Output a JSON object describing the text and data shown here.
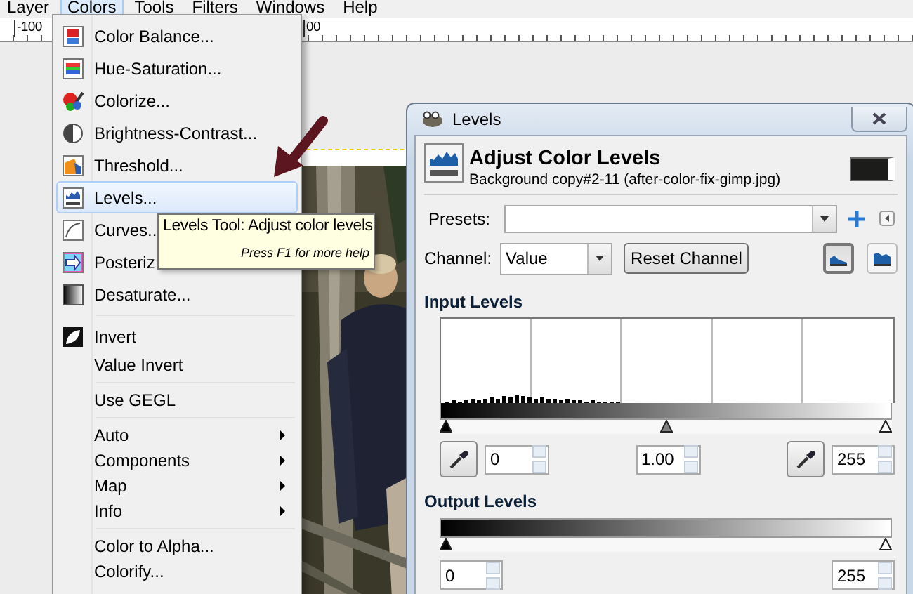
{
  "menubar": [
    {
      "label": "Layer",
      "selected": false
    },
    {
      "label": "Colors",
      "selected": true
    },
    {
      "label": "Tools",
      "selected": false
    },
    {
      "label": "Filters",
      "selected": false
    },
    {
      "label": "Windows",
      "selected": false
    },
    {
      "label": "Help",
      "selected": false
    }
  ],
  "ruler": {
    "labels": [
      "-100",
      "00"
    ]
  },
  "colors_menu": {
    "items": [
      {
        "kind": "icon-item",
        "label": "Color Balance...",
        "selected": false
      },
      {
        "kind": "icon-item",
        "label": "Hue-Saturation...",
        "selected": false
      },
      {
        "kind": "icon-item",
        "label": "Colorize...",
        "selected": false
      },
      {
        "kind": "icon-item",
        "label": "Brightness-Contrast...",
        "selected": false
      },
      {
        "kind": "icon-item",
        "label": "Threshold...",
        "selected": false
      },
      {
        "kind": "icon-item",
        "label": "Levels...",
        "selected": true
      },
      {
        "kind": "icon-item",
        "label": "Curves..",
        "selected": false
      },
      {
        "kind": "icon-item",
        "label": "Posteriz",
        "selected": false
      },
      {
        "kind": "icon-item",
        "label": "Desaturate...",
        "selected": false
      },
      {
        "kind": "separator"
      },
      {
        "kind": "icon-item",
        "label": "Invert",
        "selected": false
      },
      {
        "kind": "item",
        "label": "Value Invert",
        "selected": false
      },
      {
        "kind": "separator"
      },
      {
        "kind": "item",
        "label": "Use GEGL",
        "selected": false
      },
      {
        "kind": "separator"
      },
      {
        "kind": "item",
        "label": "Auto",
        "submenu": true,
        "selected": false
      },
      {
        "kind": "item",
        "label": "Components",
        "submenu": true,
        "selected": false
      },
      {
        "kind": "item",
        "label": "Map",
        "submenu": true,
        "selected": false
      },
      {
        "kind": "item",
        "label": "Info",
        "submenu": true,
        "selected": false
      },
      {
        "kind": "separator"
      },
      {
        "kind": "item",
        "label": "Color to Alpha...",
        "selected": false
      },
      {
        "kind": "item",
        "label": "Colorify...",
        "selected": false
      }
    ]
  },
  "tooltip": {
    "title": "Levels Tool: Adjust color levels",
    "hint": "Press F1 for more help"
  },
  "levels_dialog": {
    "title": "Levels",
    "heading": "Adjust Color Levels",
    "subtitle": "Background copy#2-11 (after-color-fix-gimp.jpg)",
    "presets_label": "Presets:",
    "channel_label": "Channel:",
    "channel_value": "Value",
    "reset_button": "Reset Channel",
    "histogram_modes": [
      {
        "selected": true
      },
      {
        "selected": false
      }
    ],
    "input_levels": {
      "heading": "Input Levels",
      "handles": [
        {
          "level": 0
        },
        {
          "level": 0.5
        },
        {
          "level": 1
        }
      ],
      "black": "0",
      "gamma": "1.00",
      "white": "255"
    },
    "output_levels": {
      "heading": "Output Levels",
      "handles": [
        {
          "level": 0
        },
        {
          "level": 1
        }
      ],
      "low": "0",
      "high": "255"
    }
  }
}
